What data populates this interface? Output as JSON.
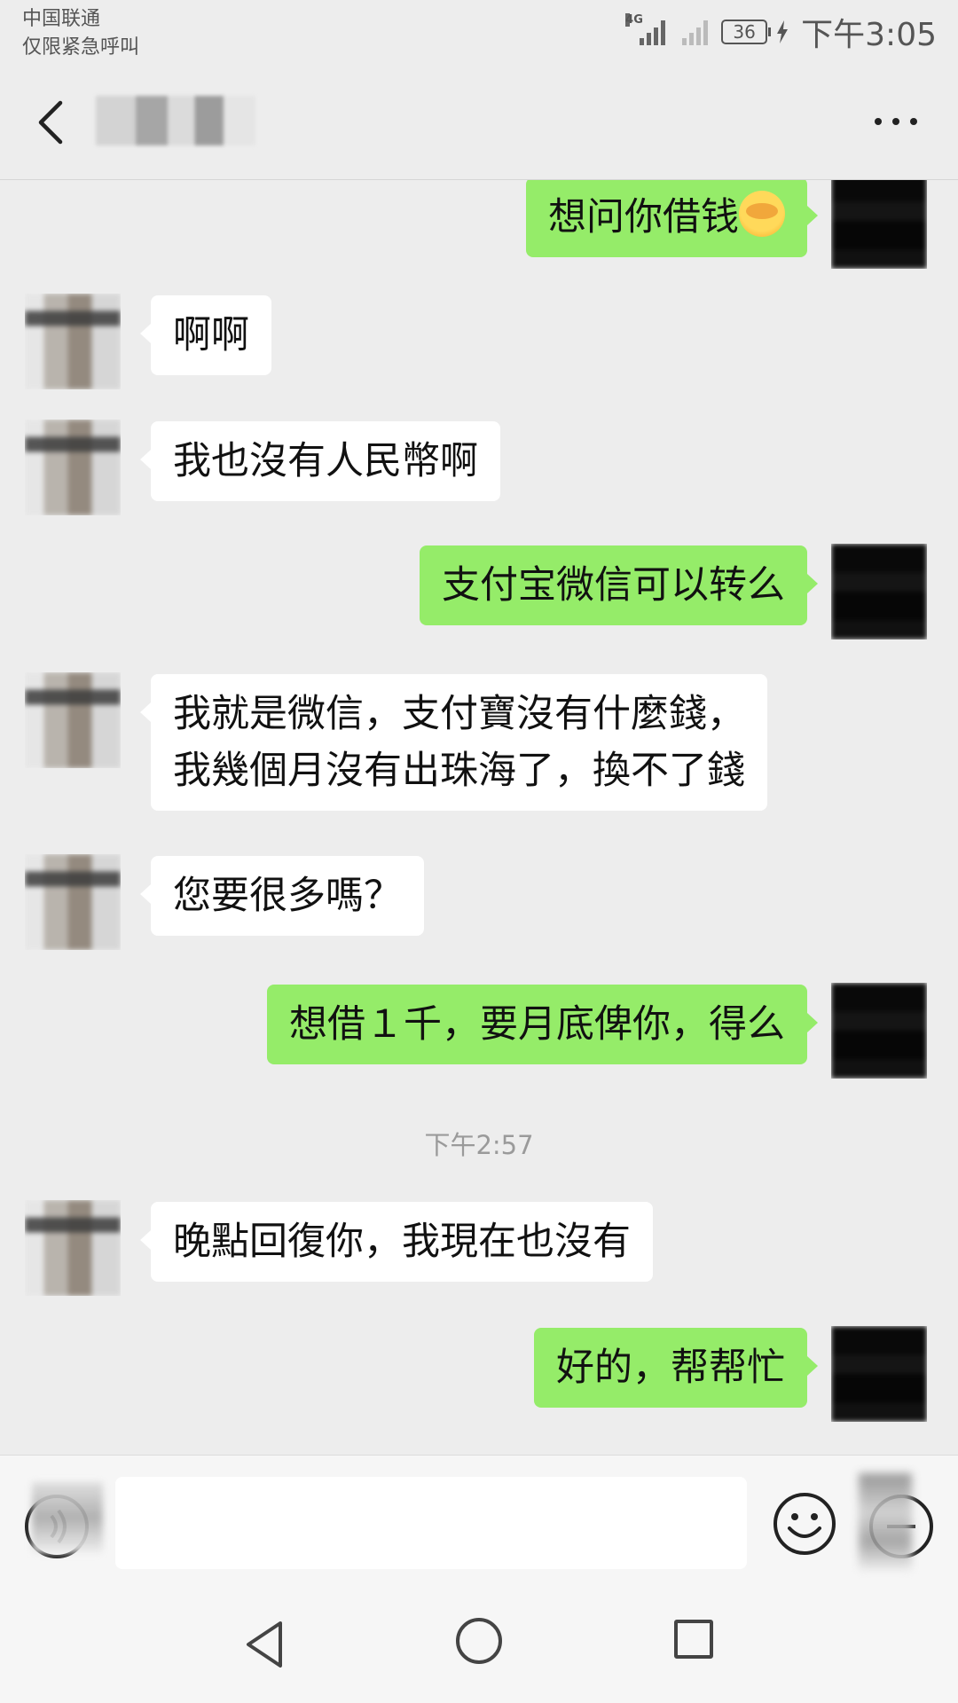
{
  "status_bar": {
    "carrier": "中国联通",
    "emergency_note": "仅限紧急呼叫",
    "network_type": "4G",
    "battery_level": "36",
    "time": "下午3:05"
  },
  "header": {
    "back_icon": "chevron-left-icon",
    "contact_name": "",
    "more_icon": "more-horizontal-icon"
  },
  "messages": [
    {
      "side": "out",
      "text": "想问你借钱",
      "emoji": "face-with-tears-of-joy"
    },
    {
      "side": "in",
      "text": "啊啊"
    },
    {
      "side": "in",
      "text": "我也沒有人民幣啊"
    },
    {
      "side": "out",
      "text": "支付宝微信可以转么"
    },
    {
      "side": "in",
      "lines": [
        "我就是微信，支付寶沒有什麼錢，",
        "我幾個月沒有出珠海了，換不了錢"
      ]
    },
    {
      "side": "in",
      "text": "您要很多嗎？"
    },
    {
      "side": "out",
      "text": "想借１千，要月底俾你，得么"
    },
    {
      "timestamp": "下午2:57"
    },
    {
      "side": "in",
      "text": "晚點回復你，我現在也沒有"
    },
    {
      "side": "out",
      "text": "好的，帮帮忙"
    }
  ],
  "input_bar": {
    "voice_icon": "voice-input-icon",
    "input_value": "",
    "emoji_icon": "smiley-icon",
    "more_icon": "plus-circle-icon"
  },
  "nav_bar": {
    "back_icon": "triangle-back-icon",
    "home_icon": "circle-home-icon",
    "recent_icon": "square-recents-icon"
  }
}
